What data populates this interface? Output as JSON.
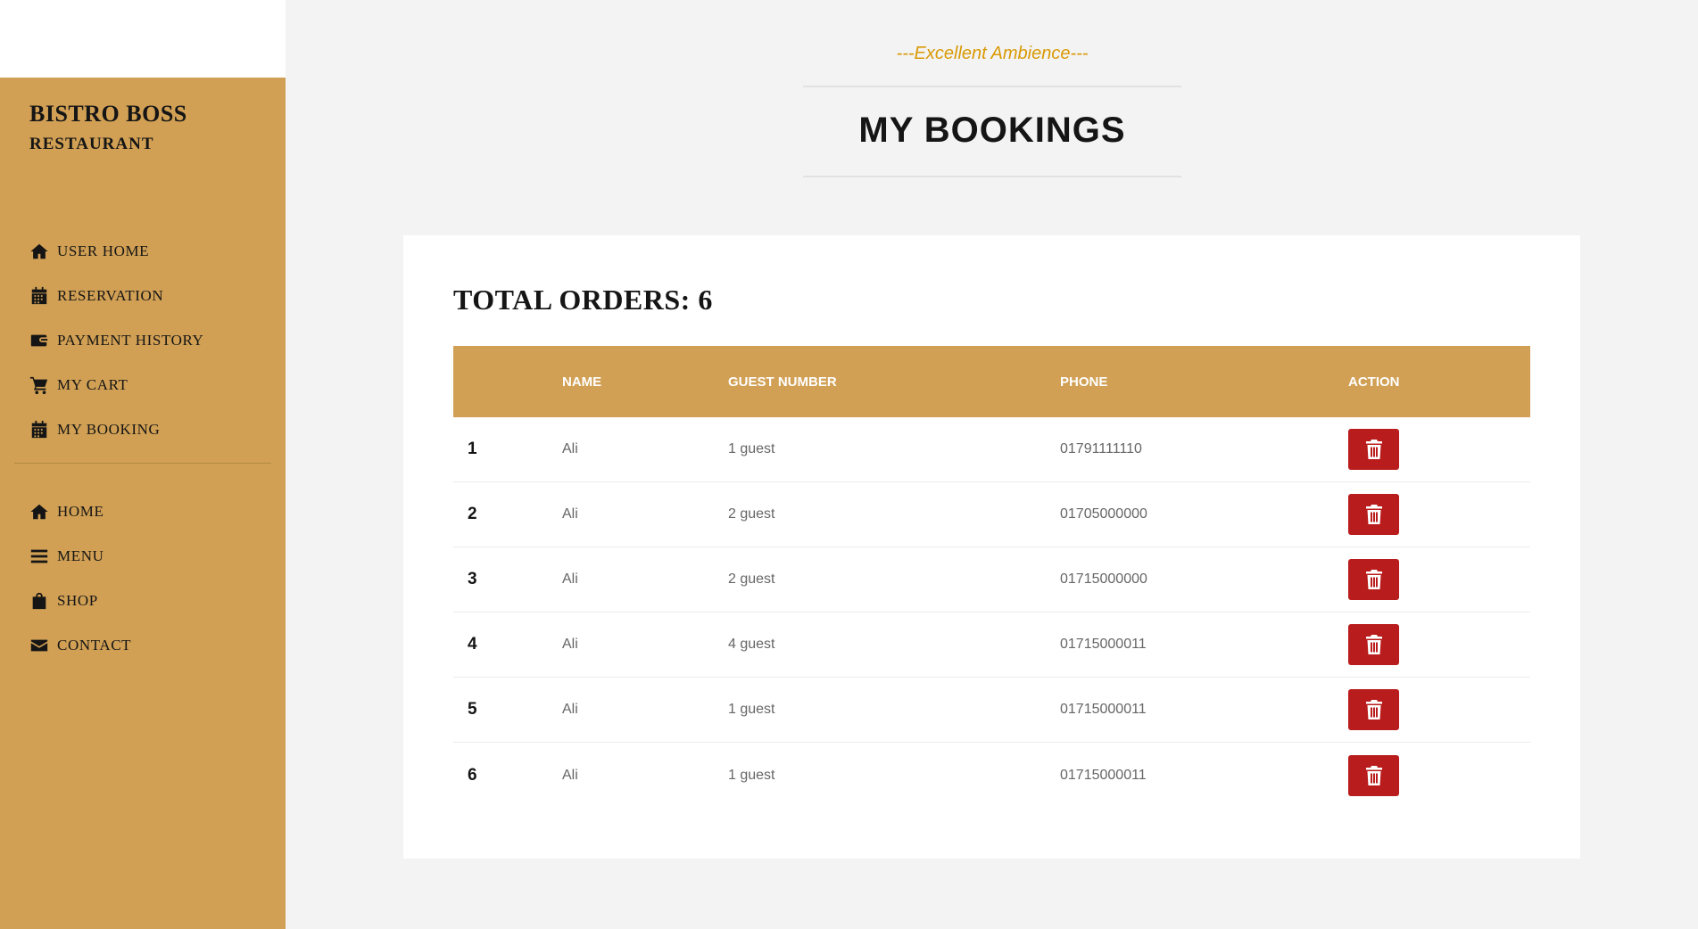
{
  "sidebar": {
    "brand_title": "BISTRO BOSS",
    "brand_subtitle": "RESTAURANT",
    "user_items": [
      {
        "label": "USER HOME",
        "icon": "home-icon"
      },
      {
        "label": "RESERVATION",
        "icon": "calendar-icon"
      },
      {
        "label": "PAYMENT HISTORY",
        "icon": "wallet-icon"
      },
      {
        "label": "MY CART",
        "icon": "cart-icon"
      },
      {
        "label": "MY BOOKING",
        "icon": "calendar-icon"
      }
    ],
    "main_items": [
      {
        "label": "HOME",
        "icon": "home-icon"
      },
      {
        "label": "MENU",
        "icon": "menu-icon"
      },
      {
        "label": "SHOP",
        "icon": "shopping-bag-icon"
      },
      {
        "label": "CONTACT",
        "icon": "envelope-icon"
      }
    ]
  },
  "header": {
    "subheading": "---Excellent Ambience---",
    "title": "MY BOOKINGS"
  },
  "bookings": {
    "total_label": "TOTAL ORDERS: 6",
    "columns": [
      "",
      "NAME",
      "GUEST NUMBER",
      "PHONE",
      "ACTION"
    ],
    "rows": [
      {
        "index": "1",
        "name": "Ali",
        "guests": "1 guest",
        "phone": "01791111110"
      },
      {
        "index": "2",
        "name": "Ali",
        "guests": "2 guest",
        "phone": "01705000000"
      },
      {
        "index": "3",
        "name": "Ali",
        "guests": "2 guest",
        "phone": "01715000000"
      },
      {
        "index": "4",
        "name": "Ali",
        "guests": "4 guest",
        "phone": "01715000011"
      },
      {
        "index": "5",
        "name": "Ali",
        "guests": "1 guest",
        "phone": "01715000011"
      },
      {
        "index": "6",
        "name": "Ali",
        "guests": "1 guest",
        "phone": "01715000011"
      }
    ]
  },
  "colors": {
    "sidebar_bg": "#d1a054",
    "accent_text": "#d99904",
    "delete_button": "#b91c1c",
    "page_bg": "#f3f3f3"
  }
}
